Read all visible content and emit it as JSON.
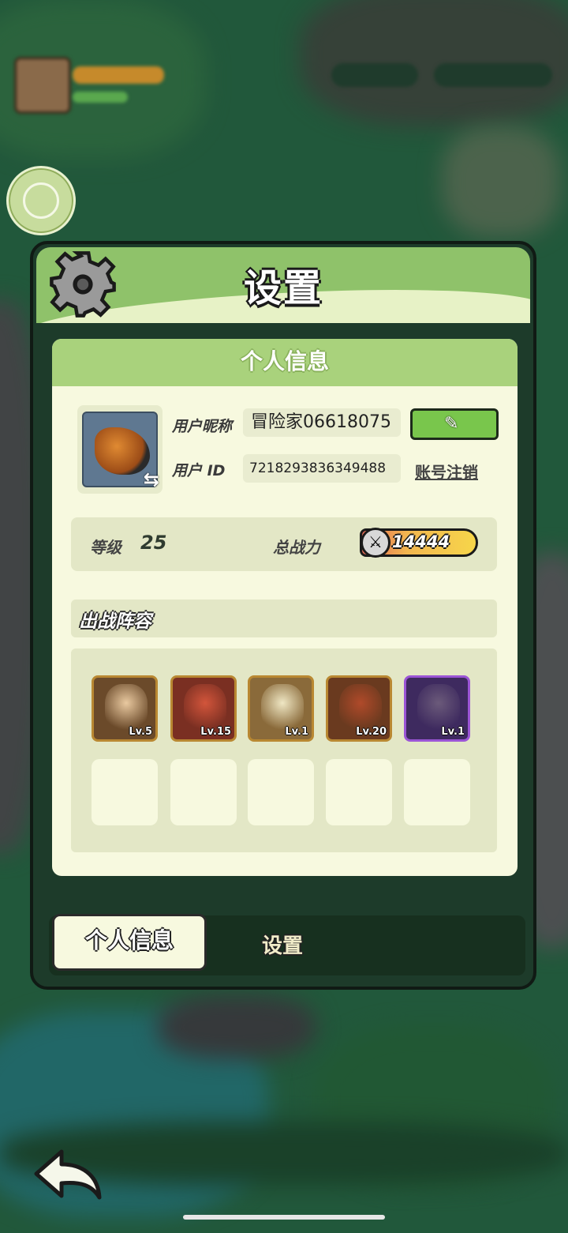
{
  "panel": {
    "title": "设置",
    "header_icon": "gear-icon"
  },
  "profile": {
    "section_title": "个人信息",
    "nickname_label": "用户昵称",
    "nickname_value": "冒险家06618075",
    "id_label": "用户 ID",
    "id_value": "7218293836349488⁠",
    "edit_icon": "pencil-icon",
    "cancel_account_label": "账号注销",
    "avatar_icon": "swap-icon"
  },
  "stats": {
    "level_label": "等级",
    "level_value": "25",
    "power_label": "总战力",
    "power_value": "14444"
  },
  "lineup": {
    "title": "出战阵容",
    "heroes": [
      {
        "level": "Lv.5",
        "border": "#b98832",
        "bg": "#6b4a2a",
        "face": "#e9c9a0"
      },
      {
        "level": "Lv.15",
        "border": "#b98832",
        "bg": "#7a2f22",
        "face": "#d2553b"
      },
      {
        "level": "Lv.1",
        "border": "#b98832",
        "bg": "#8a6a3a",
        "face": "#efe7c4"
      },
      {
        "level": "Lv.20",
        "border": "#b98832",
        "bg": "#6a3a1f",
        "face": "#b04a2a"
      },
      {
        "level": "Lv.1",
        "border": "#9b55d6",
        "bg": "#3e2a5f",
        "face": "#6b5a7a"
      }
    ]
  },
  "tabs": {
    "active": "个人信息",
    "inactive": "设置"
  },
  "hud": {
    "back_icon": "back-arrow-icon",
    "planet_icon": "planet-icon"
  }
}
